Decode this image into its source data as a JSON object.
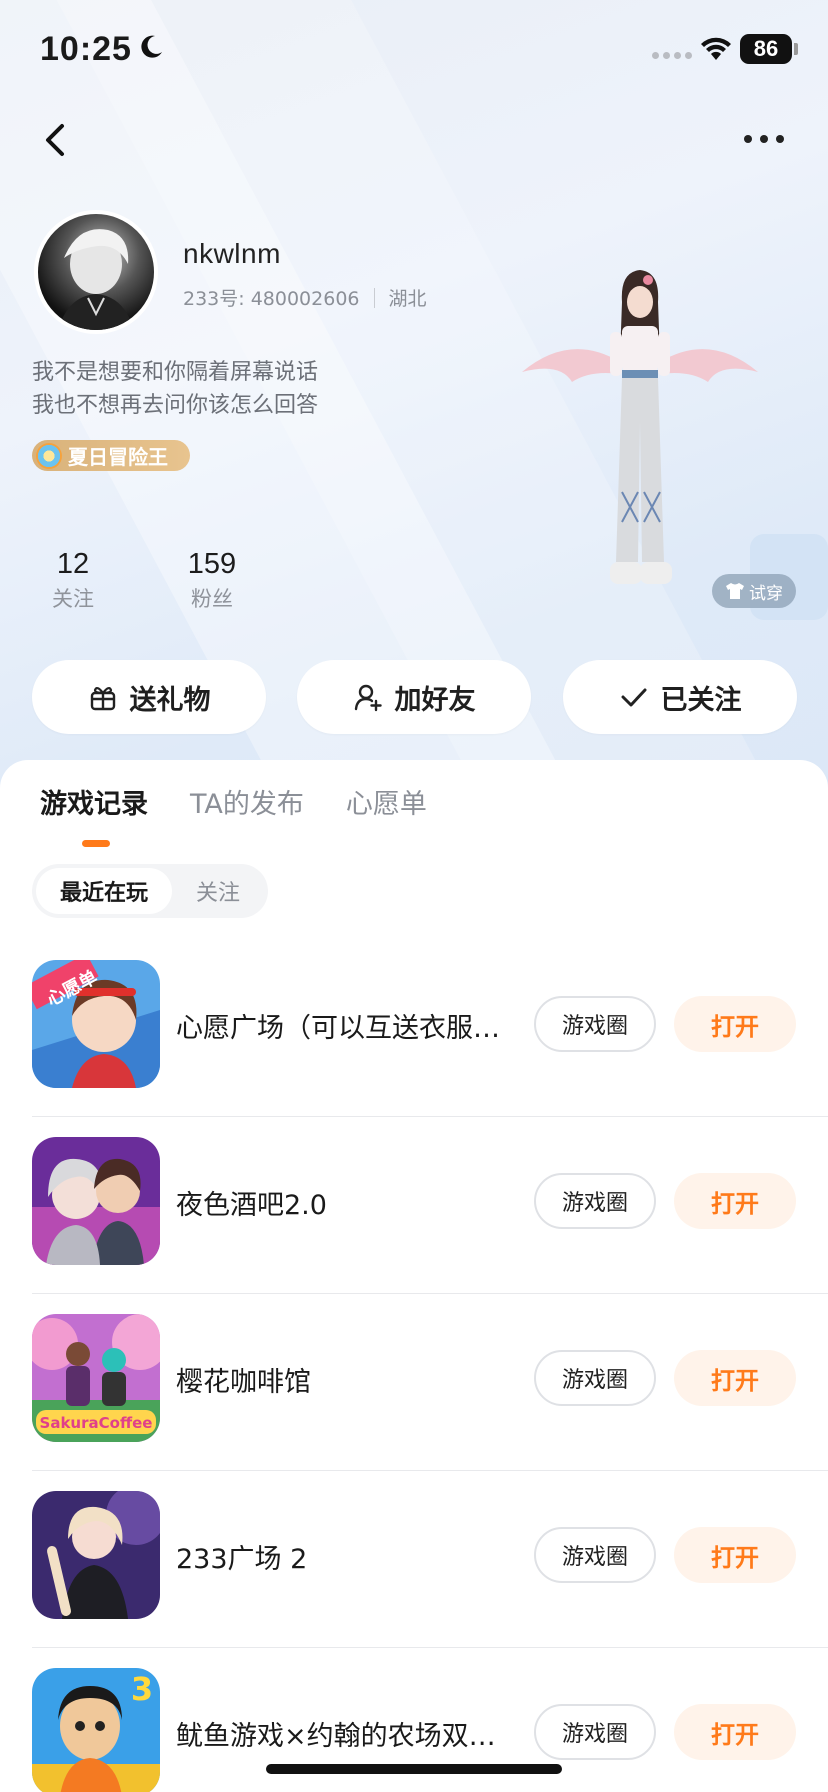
{
  "status_bar": {
    "time": "10:25",
    "battery": "86"
  },
  "profile": {
    "username": "nkwlnm",
    "id_text": "233号: 480002606",
    "location": "湖北",
    "bio_line1": "我不是想要和你隔着屏幕说话",
    "bio_line2": "我也不想再去问你该怎么回答",
    "badge": "夏日冒险王",
    "following_count": "12",
    "following_label": "关注",
    "fans_count": "159",
    "fans_label": "粉丝",
    "tryon_label": "试穿"
  },
  "actions": {
    "gift": "送礼物",
    "add_friend": "加好友",
    "followed": "已关注"
  },
  "tabs": [
    "游戏记录",
    "TA的发布",
    "心愿单"
  ],
  "segments": [
    "最近在玩",
    "关注"
  ],
  "games": [
    {
      "name": "心愿广场（可以互送衣服…",
      "circle": "游戏圈",
      "open": "打开"
    },
    {
      "name": "夜色酒吧2.0",
      "circle": "游戏圈",
      "open": "打开"
    },
    {
      "name": "樱花咖啡馆",
      "circle": "游戏圈",
      "open": "打开"
    },
    {
      "name": "233广场 2",
      "circle": "游戏圈",
      "open": "打开"
    },
    {
      "name": "鱿鱼游戏×约翰的农场双…",
      "circle": "游戏圈",
      "open": "打开"
    }
  ],
  "icon_labels": {
    "game1_tag": "心愿单",
    "game3_logo": "SakuraCoffee",
    "game5_tag": "3"
  },
  "colors": {
    "accent": "#ff7a1a",
    "open_bg": "#fff3ea"
  }
}
